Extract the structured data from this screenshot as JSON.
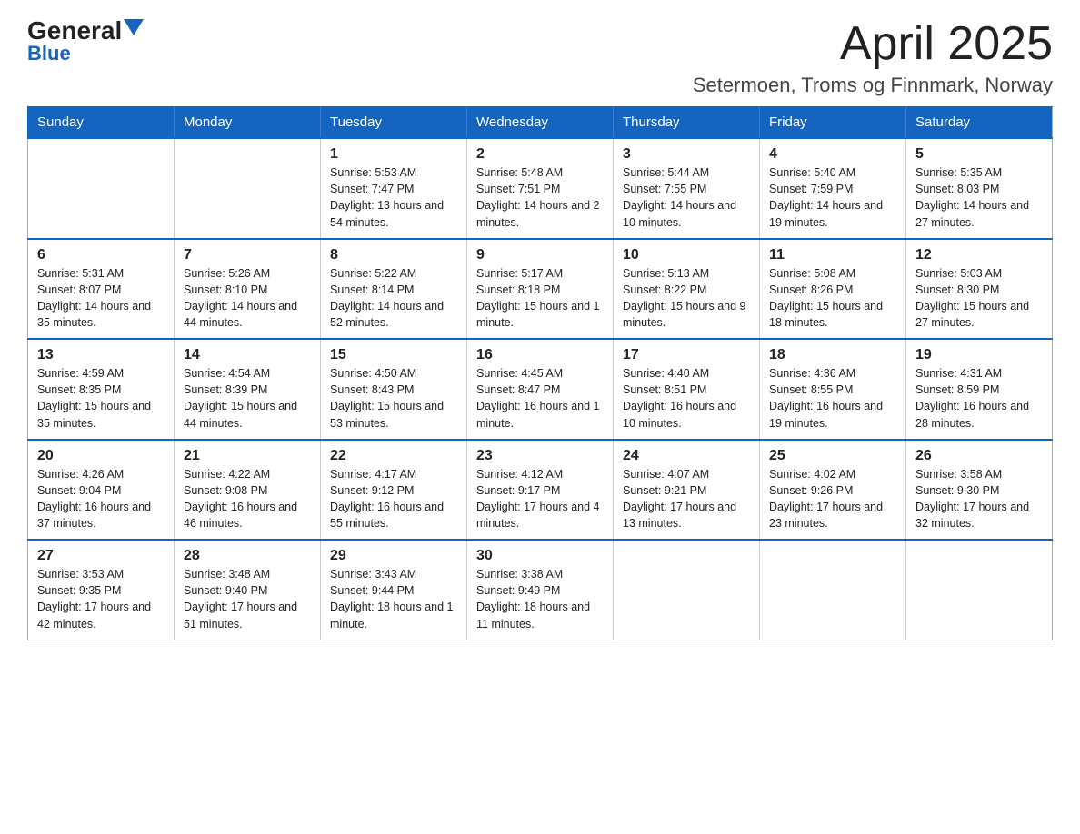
{
  "header": {
    "logo_general": "General",
    "logo_blue": "Blue",
    "month_title": "April 2025",
    "location": "Setermoen, Troms og Finnmark, Norway"
  },
  "weekdays": [
    "Sunday",
    "Monday",
    "Tuesday",
    "Wednesday",
    "Thursday",
    "Friday",
    "Saturday"
  ],
  "weeks": [
    [
      {
        "day": "",
        "info": ""
      },
      {
        "day": "",
        "info": ""
      },
      {
        "day": "1",
        "info": "Sunrise: 5:53 AM\nSunset: 7:47 PM\nDaylight: 13 hours\nand 54 minutes."
      },
      {
        "day": "2",
        "info": "Sunrise: 5:48 AM\nSunset: 7:51 PM\nDaylight: 14 hours\nand 2 minutes."
      },
      {
        "day": "3",
        "info": "Sunrise: 5:44 AM\nSunset: 7:55 PM\nDaylight: 14 hours\nand 10 minutes."
      },
      {
        "day": "4",
        "info": "Sunrise: 5:40 AM\nSunset: 7:59 PM\nDaylight: 14 hours\nand 19 minutes."
      },
      {
        "day": "5",
        "info": "Sunrise: 5:35 AM\nSunset: 8:03 PM\nDaylight: 14 hours\nand 27 minutes."
      }
    ],
    [
      {
        "day": "6",
        "info": "Sunrise: 5:31 AM\nSunset: 8:07 PM\nDaylight: 14 hours\nand 35 minutes."
      },
      {
        "day": "7",
        "info": "Sunrise: 5:26 AM\nSunset: 8:10 PM\nDaylight: 14 hours\nand 44 minutes."
      },
      {
        "day": "8",
        "info": "Sunrise: 5:22 AM\nSunset: 8:14 PM\nDaylight: 14 hours\nand 52 minutes."
      },
      {
        "day": "9",
        "info": "Sunrise: 5:17 AM\nSunset: 8:18 PM\nDaylight: 15 hours\nand 1 minute."
      },
      {
        "day": "10",
        "info": "Sunrise: 5:13 AM\nSunset: 8:22 PM\nDaylight: 15 hours\nand 9 minutes."
      },
      {
        "day": "11",
        "info": "Sunrise: 5:08 AM\nSunset: 8:26 PM\nDaylight: 15 hours\nand 18 minutes."
      },
      {
        "day": "12",
        "info": "Sunrise: 5:03 AM\nSunset: 8:30 PM\nDaylight: 15 hours\nand 27 minutes."
      }
    ],
    [
      {
        "day": "13",
        "info": "Sunrise: 4:59 AM\nSunset: 8:35 PM\nDaylight: 15 hours\nand 35 minutes."
      },
      {
        "day": "14",
        "info": "Sunrise: 4:54 AM\nSunset: 8:39 PM\nDaylight: 15 hours\nand 44 minutes."
      },
      {
        "day": "15",
        "info": "Sunrise: 4:50 AM\nSunset: 8:43 PM\nDaylight: 15 hours\nand 53 minutes."
      },
      {
        "day": "16",
        "info": "Sunrise: 4:45 AM\nSunset: 8:47 PM\nDaylight: 16 hours\nand 1 minute."
      },
      {
        "day": "17",
        "info": "Sunrise: 4:40 AM\nSunset: 8:51 PM\nDaylight: 16 hours\nand 10 minutes."
      },
      {
        "day": "18",
        "info": "Sunrise: 4:36 AM\nSunset: 8:55 PM\nDaylight: 16 hours\nand 19 minutes."
      },
      {
        "day": "19",
        "info": "Sunrise: 4:31 AM\nSunset: 8:59 PM\nDaylight: 16 hours\nand 28 minutes."
      }
    ],
    [
      {
        "day": "20",
        "info": "Sunrise: 4:26 AM\nSunset: 9:04 PM\nDaylight: 16 hours\nand 37 minutes."
      },
      {
        "day": "21",
        "info": "Sunrise: 4:22 AM\nSunset: 9:08 PM\nDaylight: 16 hours\nand 46 minutes."
      },
      {
        "day": "22",
        "info": "Sunrise: 4:17 AM\nSunset: 9:12 PM\nDaylight: 16 hours\nand 55 minutes."
      },
      {
        "day": "23",
        "info": "Sunrise: 4:12 AM\nSunset: 9:17 PM\nDaylight: 17 hours\nand 4 minutes."
      },
      {
        "day": "24",
        "info": "Sunrise: 4:07 AM\nSunset: 9:21 PM\nDaylight: 17 hours\nand 13 minutes."
      },
      {
        "day": "25",
        "info": "Sunrise: 4:02 AM\nSunset: 9:26 PM\nDaylight: 17 hours\nand 23 minutes."
      },
      {
        "day": "26",
        "info": "Sunrise: 3:58 AM\nSunset: 9:30 PM\nDaylight: 17 hours\nand 32 minutes."
      }
    ],
    [
      {
        "day": "27",
        "info": "Sunrise: 3:53 AM\nSunset: 9:35 PM\nDaylight: 17 hours\nand 42 minutes."
      },
      {
        "day": "28",
        "info": "Sunrise: 3:48 AM\nSunset: 9:40 PM\nDaylight: 17 hours\nand 51 minutes."
      },
      {
        "day": "29",
        "info": "Sunrise: 3:43 AM\nSunset: 9:44 PM\nDaylight: 18 hours\nand 1 minute."
      },
      {
        "day": "30",
        "info": "Sunrise: 3:38 AM\nSunset: 9:49 PM\nDaylight: 18 hours\nand 11 minutes."
      },
      {
        "day": "",
        "info": ""
      },
      {
        "day": "",
        "info": ""
      },
      {
        "day": "",
        "info": ""
      }
    ]
  ]
}
